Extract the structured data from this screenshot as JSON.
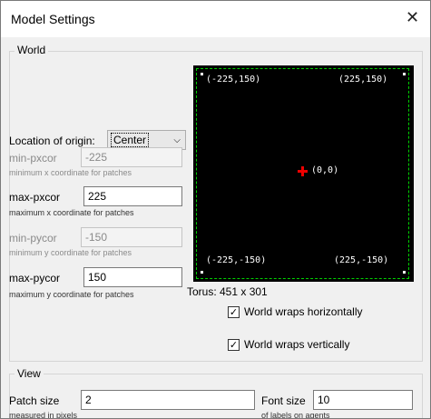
{
  "window": {
    "title": "Model Settings",
    "close_glyph": "✕"
  },
  "world_group": {
    "legend": "World"
  },
  "origin": {
    "label": "Location of origin:",
    "value": "Center",
    "chevron": "⌵"
  },
  "min_pxcor": {
    "label": "min-pxcor",
    "value": "-225",
    "hint": "minimum x coordinate for patches"
  },
  "max_pxcor": {
    "label": "max-pxcor",
    "value": "225",
    "hint": "maximum x coordinate for patches"
  },
  "min_pycor": {
    "label": "min-pycor",
    "value": "-150",
    "hint": "minimum y coordinate for patches"
  },
  "max_pycor": {
    "label": "max-pycor",
    "value": "150",
    "hint": "maximum y coordinate for patches"
  },
  "preview": {
    "top_left": "(-225,150)",
    "top_right": "(225,150)",
    "center": "(0,0)",
    "bottom_left": "(-225,-150)",
    "bottom_right": "(225,-150)",
    "border_color": "#00d000",
    "origin_color": "#e00000"
  },
  "torus": {
    "text": "Torus: 451 x 301"
  },
  "wrap_h": {
    "label": "World wraps horizontally",
    "checked": "✓"
  },
  "wrap_v": {
    "label": "World wraps vertically",
    "checked": "✓"
  },
  "view_group": {
    "legend": "View"
  },
  "patch_size": {
    "label": "Patch size",
    "value": "2",
    "hint": "measured in pixels"
  },
  "font_size": {
    "label": "Font size",
    "value": "10",
    "hint": "of labels on agents"
  }
}
